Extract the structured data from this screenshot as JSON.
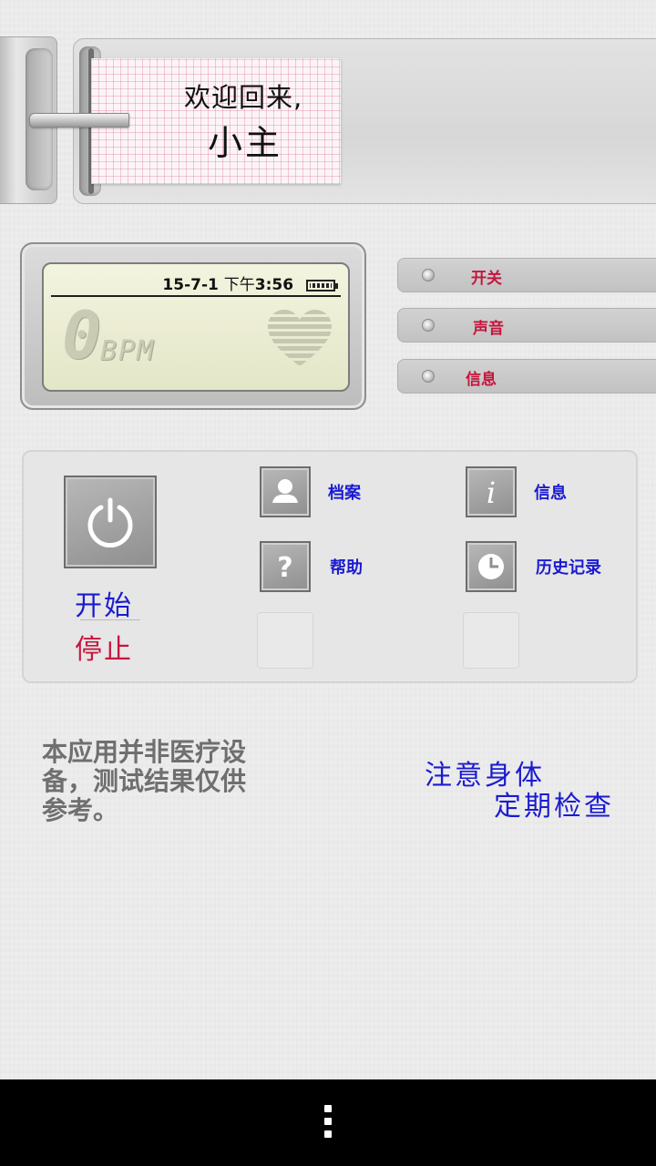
{
  "header": {
    "welcome_line1": "欢迎回来,",
    "welcome_line2": "小主"
  },
  "lcd": {
    "date": "15-7-1",
    "ampm": "下午",
    "time": "3:56",
    "bpm_value": "0",
    "bpm_unit": "BPM"
  },
  "toggles": [
    {
      "label": "开关"
    },
    {
      "label": "声音"
    },
    {
      "label": "信息"
    }
  ],
  "controls": {
    "start_label": "开始",
    "stop_label": "停止"
  },
  "menu": {
    "profile_label": "档案",
    "info_label": "信息",
    "help_label": "帮助",
    "history_label": "历史记录"
  },
  "notes": {
    "disclaimer": "本应用并非医疗设备，测试结果仅供参考。",
    "slogan_line1": "注意身体",
    "slogan_line2": "定期检查"
  },
  "colors": {
    "accent_red": "#c4163d",
    "accent_blue": "#1b1bd1",
    "lcd_background": "#eef0d6"
  },
  "icons": [
    "heart-icon",
    "power-icon",
    "profile-icon",
    "info-icon",
    "help-icon",
    "clock-icon",
    "battery-icon",
    "menu-dots-icon"
  ]
}
